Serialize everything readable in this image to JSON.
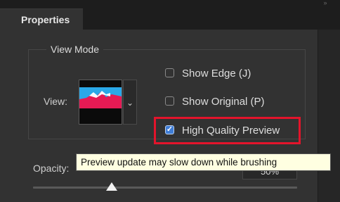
{
  "panel": {
    "tab_label": "Properties",
    "collapse_icon": "double-chevron-right-icon"
  },
  "view_mode": {
    "section_title": "View Mode",
    "view_label": "View:",
    "thumbnail_icon": "view-mode-thumbnail",
    "dropdown_icon": "chevron-down-icon",
    "options": [
      {
        "label": "Show Edge (J)",
        "checked": false
      },
      {
        "label": "Show Original (P)",
        "checked": false
      },
      {
        "label": "High Quality Preview",
        "checked": true
      }
    ]
  },
  "opacity": {
    "label": "Opacity:",
    "value_percent": 50,
    "field_value": "50%"
  },
  "tooltip": {
    "text": "Preview update may slow down while brushing"
  },
  "colors": {
    "panel_bg": "#323232",
    "highlight": "#e3142b",
    "checkbox_checked": "#3f7dd6",
    "tooltip_bg": "#ffffe1"
  }
}
